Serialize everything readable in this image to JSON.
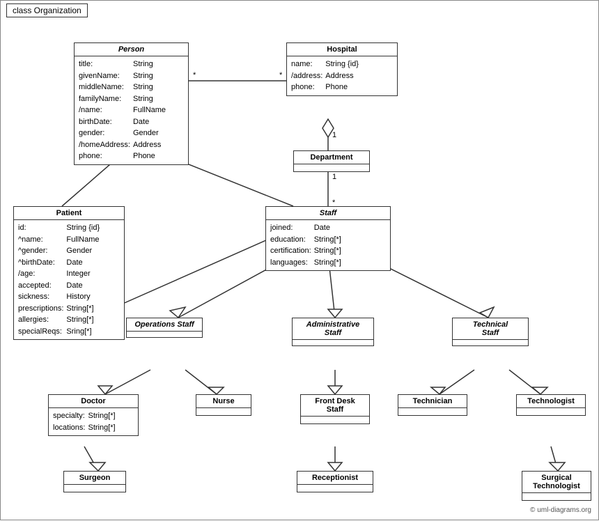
{
  "title": "class Organization",
  "classes": {
    "person": {
      "name": "Person",
      "italic": true,
      "fields": [
        [
          "title:",
          "String"
        ],
        [
          "givenName:",
          "String"
        ],
        [
          "middleName:",
          "String"
        ],
        [
          "familyName:",
          "String"
        ],
        [
          "/name:",
          "FullName"
        ],
        [
          "birthDate:",
          "Date"
        ],
        [
          "gender:",
          "Gender"
        ],
        [
          "/homeAddress:",
          "Address"
        ],
        [
          "phone:",
          "Phone"
        ]
      ]
    },
    "hospital": {
      "name": "Hospital",
      "italic": false,
      "fields": [
        [
          "name:",
          "String {id}"
        ],
        [
          "/address:",
          "Address"
        ],
        [
          "phone:",
          "Phone"
        ]
      ]
    },
    "department": {
      "name": "Department",
      "italic": false,
      "fields": []
    },
    "staff": {
      "name": "Staff",
      "italic": true,
      "fields": [
        [
          "joined:",
          "Date"
        ],
        [
          "education:",
          "String[*]"
        ],
        [
          "certification:",
          "String[*]"
        ],
        [
          "languages:",
          "String[*]"
        ]
      ]
    },
    "patient": {
      "name": "Patient",
      "italic": false,
      "fields": [
        [
          "id:",
          "String {id}"
        ],
        [
          "^name:",
          "FullName"
        ],
        [
          "^gender:",
          "Gender"
        ],
        [
          "^birthDate:",
          "Date"
        ],
        [
          "/age:",
          "Integer"
        ],
        [
          "accepted:",
          "Date"
        ],
        [
          "sickness:",
          "History"
        ],
        [
          "prescriptions:",
          "String[*]"
        ],
        [
          "allergies:",
          "String[*]"
        ],
        [
          "specialReqs:",
          "Sring[*]"
        ]
      ]
    },
    "operations_staff": {
      "name": "Operations Staff",
      "italic": true,
      "fields": []
    },
    "administrative_staff": {
      "name": "Administrative Staff",
      "italic": true,
      "fields": []
    },
    "technical_staff": {
      "name": "Technical Staff",
      "italic": true,
      "fields": []
    },
    "doctor": {
      "name": "Doctor",
      "italic": false,
      "fields": [
        [
          "specialty:",
          "String[*]"
        ],
        [
          "locations:",
          "String[*]"
        ]
      ]
    },
    "nurse": {
      "name": "Nurse",
      "italic": false,
      "fields": []
    },
    "front_desk_staff": {
      "name": "Front Desk Staff",
      "italic": false,
      "fields": []
    },
    "technician": {
      "name": "Technician",
      "italic": false,
      "fields": []
    },
    "technologist": {
      "name": "Technologist",
      "italic": false,
      "fields": []
    },
    "surgeon": {
      "name": "Surgeon",
      "italic": false,
      "fields": []
    },
    "receptionist": {
      "name": "Receptionist",
      "italic": false,
      "fields": []
    },
    "surgical_technologist": {
      "name": "Surgical Technologist",
      "italic": false,
      "fields": []
    }
  },
  "multiplicity": {
    "star": "*",
    "one": "1"
  },
  "copyright": "© uml-diagrams.org"
}
